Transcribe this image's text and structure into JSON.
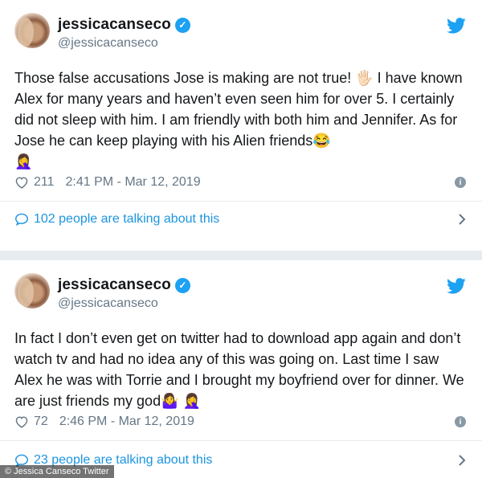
{
  "tweets": [
    {
      "name": "jessicacanseco",
      "handle": "@jessicacanseco",
      "text": "Those false accusations Jose is making are not true! 🖐🏻 I have known Alex for many years and haven’t even seen him for over 5. I certainly did not sleep with him. I am friendly with both him and Jennifer. As for Jose he can keep playing with his Alien friends😂\n🤦‍♀️",
      "likes": "211",
      "timestamp": "2:41 PM - Mar 12, 2019",
      "talking": "102 people are talking about this"
    },
    {
      "name": "jessicacanseco",
      "handle": "@jessicacanseco",
      "text": "In fact I don’t even get on twitter had to download app again and don’t watch tv and had no idea any of this was going on.  Last time I saw Alex he was with Torrie and I brought my boyfriend over for dinner. We are just friends my god🤷‍♀️ 🤦‍♀️",
      "likes": "72",
      "timestamp": "2:46 PM - Mar 12, 2019",
      "talking": "23 people are talking about this"
    }
  ],
  "credit": "© Jessica Canseco Twitter",
  "colors": {
    "twitter_blue": "#1da1f2",
    "link_blue": "#1b95e0",
    "muted": "#657786"
  },
  "icons": {
    "verified": "verified-badge-icon",
    "bird": "twitter-bird-icon",
    "heart": "heart-icon",
    "info": "info-icon",
    "bubble": "speech-bubble-icon",
    "chevron": "chevron-right-icon"
  }
}
